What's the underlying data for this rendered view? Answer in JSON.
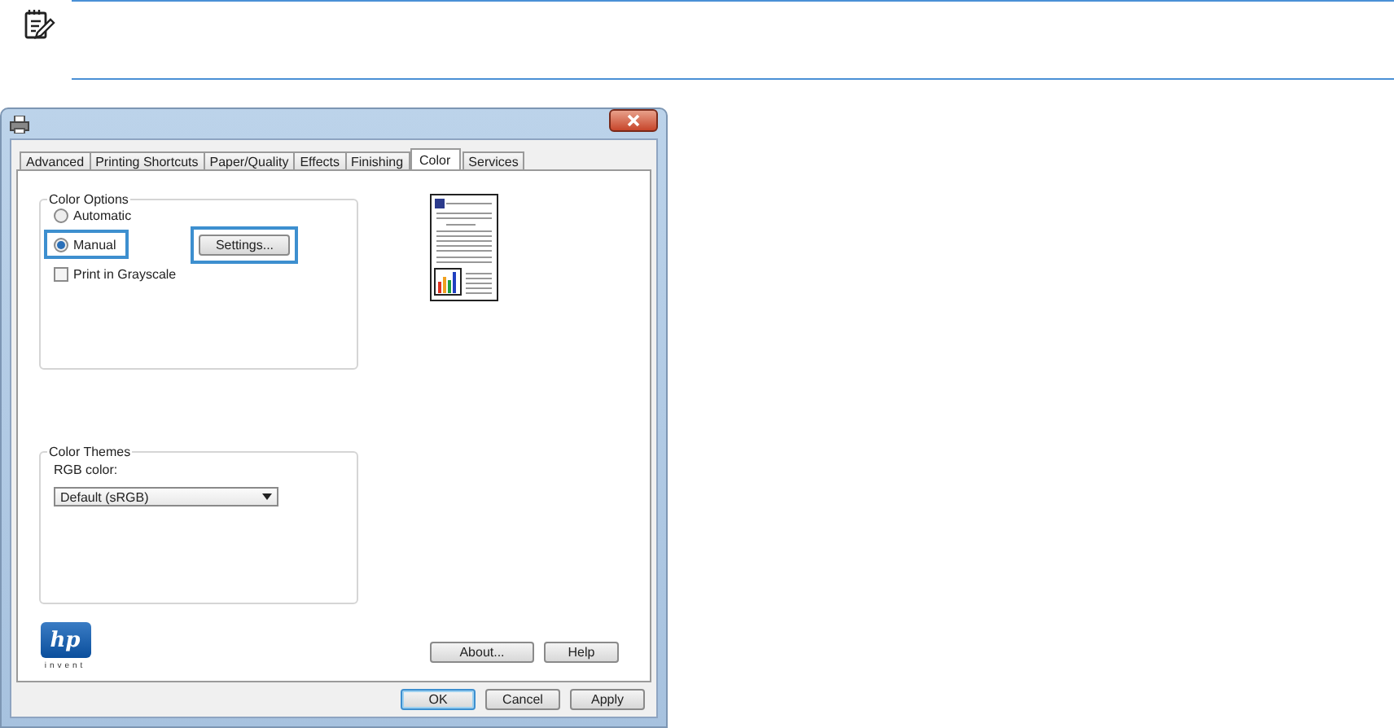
{
  "tabs": [
    {
      "label": "Advanced",
      "selected": false
    },
    {
      "label": "Printing Shortcuts",
      "selected": false
    },
    {
      "label": "Paper/Quality",
      "selected": false
    },
    {
      "label": "Effects",
      "selected": false
    },
    {
      "label": "Finishing",
      "selected": false
    },
    {
      "label": "Color",
      "selected": true
    },
    {
      "label": "Services",
      "selected": false
    }
  ],
  "color_options": {
    "title": "Color Options",
    "options": [
      {
        "label": "Automatic",
        "selected": false,
        "highlighted": false
      },
      {
        "label": "Manual",
        "selected": true,
        "highlighted": true
      }
    ],
    "settings_button": {
      "label": "Settings...",
      "highlighted": true
    },
    "grayscale": {
      "label": "Print in Grayscale",
      "checked": false
    }
  },
  "color_themes": {
    "title": "Color Themes",
    "label": "RGB color:",
    "dropdown": {
      "value": "Default (sRGB)"
    }
  },
  "logo": {
    "mark": "hp",
    "tagline": "invent"
  },
  "panel_buttons": [
    "About...",
    "Help"
  ],
  "dialog_buttons": [
    {
      "label": "OK",
      "default": true
    },
    {
      "label": "Cancel",
      "default": false
    },
    {
      "label": "Apply",
      "default": false
    }
  ]
}
